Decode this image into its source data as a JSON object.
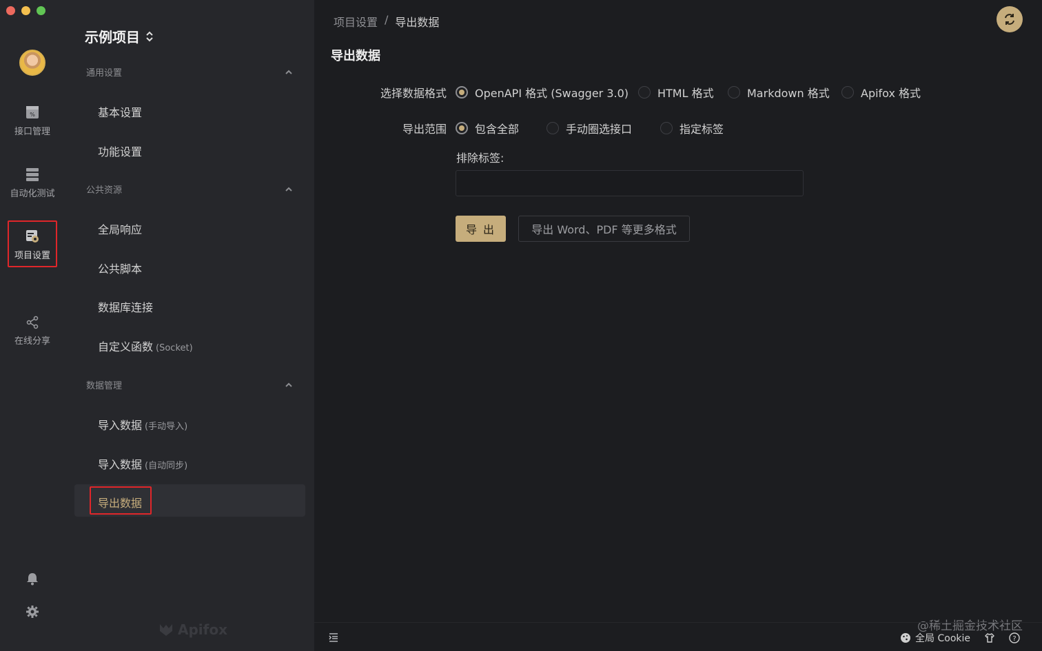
{
  "window": {
    "traffic_lights": [
      "close",
      "minimize",
      "zoom"
    ]
  },
  "rail": {
    "items": [
      {
        "label": "接口管理",
        "icon": "api-icon"
      },
      {
        "label": "自动化测试",
        "icon": "test-icon"
      },
      {
        "label": "项目设置",
        "icon": "project-settings-icon"
      },
      {
        "label": "在线分享",
        "icon": "share-icon"
      }
    ],
    "bottom_icons": [
      "bell-icon",
      "gear-icon"
    ]
  },
  "panel": {
    "project_title": "示例项目",
    "sections": [
      {
        "title": "通用设置",
        "items": [
          "基本设置",
          "功能设置"
        ]
      },
      {
        "title": "公共资源",
        "items": [
          "全局响应",
          "公共脚本",
          "数据库连接"
        ],
        "custom_fn": {
          "label": "自定义函数",
          "sub": "(Socket)"
        }
      },
      {
        "title": "数据管理",
        "import_manual": {
          "label": "导入数据",
          "sub": "(手动导入)"
        },
        "import_auto": {
          "label": "导入数据",
          "sub": "(自动同步)"
        },
        "export": "导出数据"
      }
    ],
    "brand": "Apifox"
  },
  "main": {
    "breadcrumb": [
      "项目设置",
      "/",
      "导出数据"
    ],
    "title": "导出数据",
    "format": {
      "label": "选择数据格式",
      "options": [
        "OpenAPI 格式 (Swagger 3.0)",
        "HTML 格式",
        "Markdown 格式",
        "Apifox 格式"
      ],
      "selected": "OpenAPI 格式 (Swagger 3.0)"
    },
    "scope": {
      "label": "导出范围",
      "options": [
        "包含全部",
        "手动圈选接口",
        "指定标签"
      ],
      "selected": "包含全部"
    },
    "exclude_label": "排除标签:",
    "exclude_value": "",
    "export_button": "导 出",
    "export_more_button": "导出 Word、PDF 等更多格式"
  },
  "statusbar": {
    "cookie": "全局 Cookie",
    "watermark": "@稀土掘金技术社区"
  },
  "colors": {
    "accent": "#c6ad7c",
    "highlight_border": "#e0262a"
  }
}
